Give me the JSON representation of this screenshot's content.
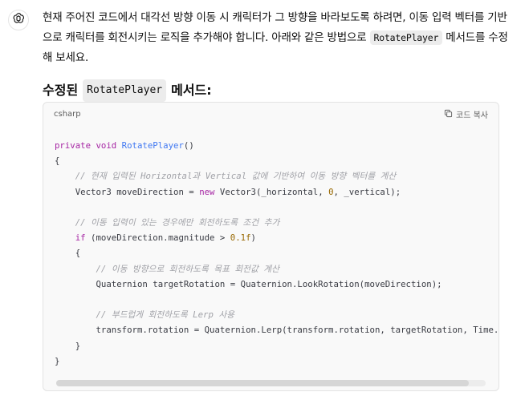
{
  "message": {
    "intro_part1": "현재 주어진 코드에서 대각선 방향 이동 시 캐릭터가 그 방향을 바라보도록 하려면, 이동 입력 벡터를 기반으로 캐릭터를 회전시키는 로직을 추가해야 합니다. 아래와 같은 방법으로 ",
    "intro_code": "RotatePlayer",
    "intro_part2": " 메서드를 수정해 보세요.",
    "heading_prefix": "수정된",
    "heading_code": "RotatePlayer",
    "heading_suffix": "메서드:"
  },
  "code_block": {
    "language": "csharp",
    "copy_label": "코드 복사",
    "lines": {
      "l1_kw1": "private",
      "l1_kw2": "void",
      "l1_fn": "RotatePlayer",
      "l1_rest": "()",
      "l2": "{",
      "l3_comment": "// 현재 입력된 Horizontal과 Vertical 값에 기반하여 이동 방향 벡터를 계산",
      "l4_a": "Vector3 moveDirection = ",
      "l4_kw": "new",
      "l4_b": " Vector3(_horizontal, ",
      "l4_num": "0",
      "l4_c": ", _vertical);",
      "l6_comment": "// 이동 입력이 있는 경우에만 회전하도록 조건 추가",
      "l7_kw": "if",
      "l7_a": " (moveDirection.magnitude > ",
      "l7_num": "0.1f",
      "l7_b": ")",
      "l8": "{",
      "l9_comment": "// 이동 방향으로 회전하도록 목표 회전값 계산",
      "l10": "Quaternion targetRotation = Quaternion.LookRotation(moveDirection);",
      "l12_comment": "// 부드럽게 회전하도록 Lerp 사용",
      "l13": "transform.rotation = Quaternion.Lerp(transform.rotation, targetRotation, Time.delt",
      "l14": "}",
      "l15": "}"
    }
  },
  "colors": {
    "keyword": "#a626a4",
    "function": "#4078f2",
    "comment": "#a0a1a7",
    "number": "#986801",
    "code_background": "#f9f9f9"
  },
  "icons": {
    "avatar": "assistant-logo-icon",
    "copy": "copy-icon"
  }
}
